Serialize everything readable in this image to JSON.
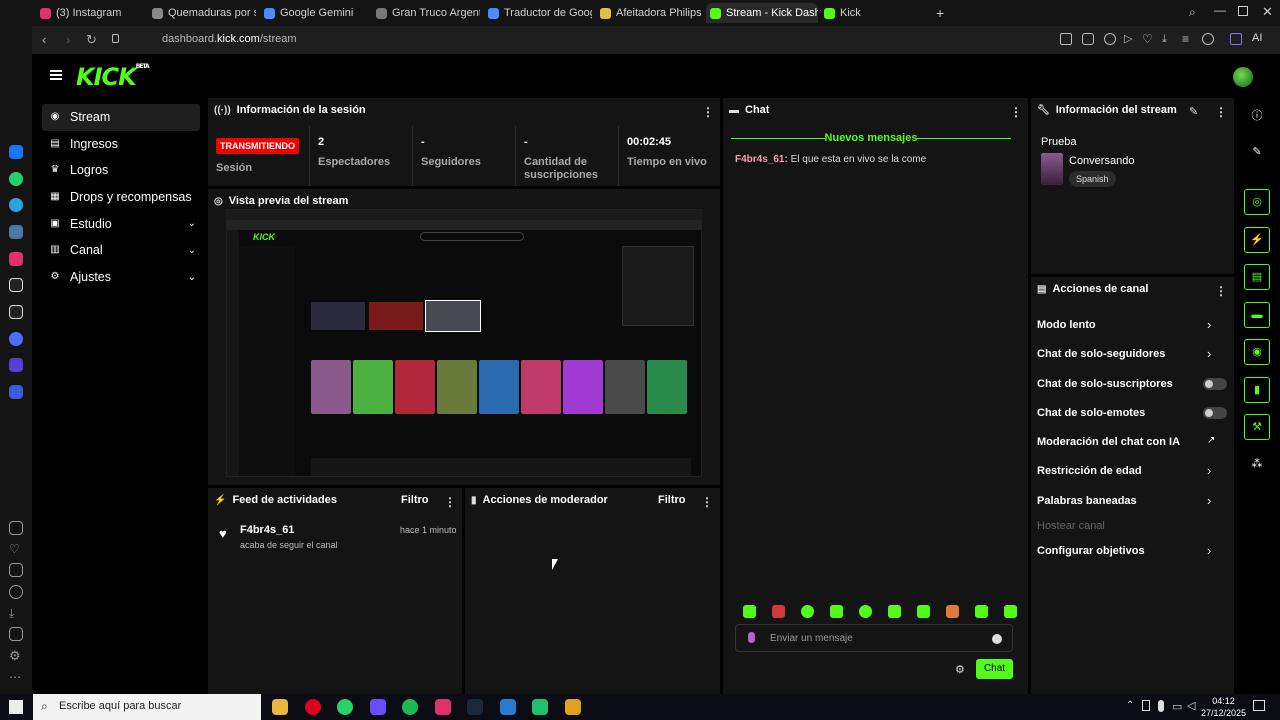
{
  "browser": {
    "tabs": [
      {
        "label": "(3) Instagram",
        "color": "#e1306c"
      },
      {
        "label": "Quemaduras por sol rápid",
        "color": "#888888"
      },
      {
        "label": "Google Gemini",
        "color": "#4a8cff"
      },
      {
        "label": "Gran Truco Argentino | Co",
        "color": "#777777"
      },
      {
        "label": "Traductor de Google",
        "color": "#4a8cff"
      },
      {
        "label": "Afeitadora Philips OneBla",
        "color": "#e0c040"
      },
      {
        "label": "Stream - Kick Dashboard",
        "color": "#53fc18"
      },
      {
        "label": "Kick",
        "color": "#53fc18"
      }
    ],
    "url_prefix": "dashboard.",
    "url_domain": "kick.com",
    "url_path": "/stream",
    "ai_label": "AI"
  },
  "page": {
    "logo": "KICK",
    "logo_sup": "BETA",
    "accent": "#53fc18"
  },
  "leftnav": {
    "items": [
      {
        "label": "Stream",
        "icon": "broadcast-icon"
      },
      {
        "label": "Ingresos",
        "icon": "wallet-icon"
      },
      {
        "label": "Logros",
        "icon": "trophy-icon"
      },
      {
        "label": "Drops y recompensas",
        "icon": "gift-icon"
      },
      {
        "label": "Estudio",
        "icon": "studio-icon"
      },
      {
        "label": "Canal",
        "icon": "channel-icon"
      },
      {
        "label": "Ajustes",
        "icon": "settings-icon"
      }
    ]
  },
  "session": {
    "title": "Información de la sesión",
    "live_badge": "TRANSMITIENDO",
    "session_label": "Sesión",
    "viewers_value": "2",
    "viewers_label": "Espectadores",
    "followers_value": "-",
    "followers_label": "Seguidores",
    "subs_value": "-",
    "subs_label_1": "Cantidad de",
    "subs_label_2": "suscripciones",
    "time_value": "00:02:45",
    "time_label": "Tiempo en vivo"
  },
  "preview": {
    "title": "Vista previa del stream"
  },
  "chat": {
    "title": "Chat",
    "new_messages": "Nuevos mensajes",
    "message_user": "F4br4s_61:",
    "message_text": " El que esta en vivo se la come",
    "input_placeholder": "Enviar un mensaje",
    "send_label": "Chat"
  },
  "stream_info": {
    "title": "Información del stream",
    "stream_title": "Prueba",
    "category": "Conversando",
    "language": "Spanish"
  },
  "channel_actions": {
    "title": "Acciones de canal",
    "items": [
      {
        "label": "Modo lento",
        "kind": "arrow"
      },
      {
        "label": "Chat de solo-seguidores",
        "kind": "arrow"
      },
      {
        "label": "Chat de solo-suscriptores",
        "kind": "toggle"
      },
      {
        "label": "Chat de solo-emotes",
        "kind": "toggle"
      },
      {
        "label": "Moderación del chat con IA",
        "kind": "external"
      },
      {
        "label": "Restricción de edad",
        "kind": "arrow"
      },
      {
        "label": "Palabras baneadas",
        "kind": "arrow"
      },
      {
        "label": "Hostear canal",
        "kind": "disabled"
      },
      {
        "label": "Configurar objetivos",
        "kind": "arrow"
      }
    ]
  },
  "feed": {
    "title": "Feed de actividades",
    "filter": "Filtro",
    "user": "F4br4s_61",
    "action": "acaba de seguir el canal",
    "time": "hace 1 minuto"
  },
  "mod": {
    "title": "Acciones de moderador",
    "filter": "Filtro"
  },
  "taskbar": {
    "search_placeholder": "Escribe aquí para buscar",
    "time": "04:12",
    "date": "27/12/2025"
  }
}
